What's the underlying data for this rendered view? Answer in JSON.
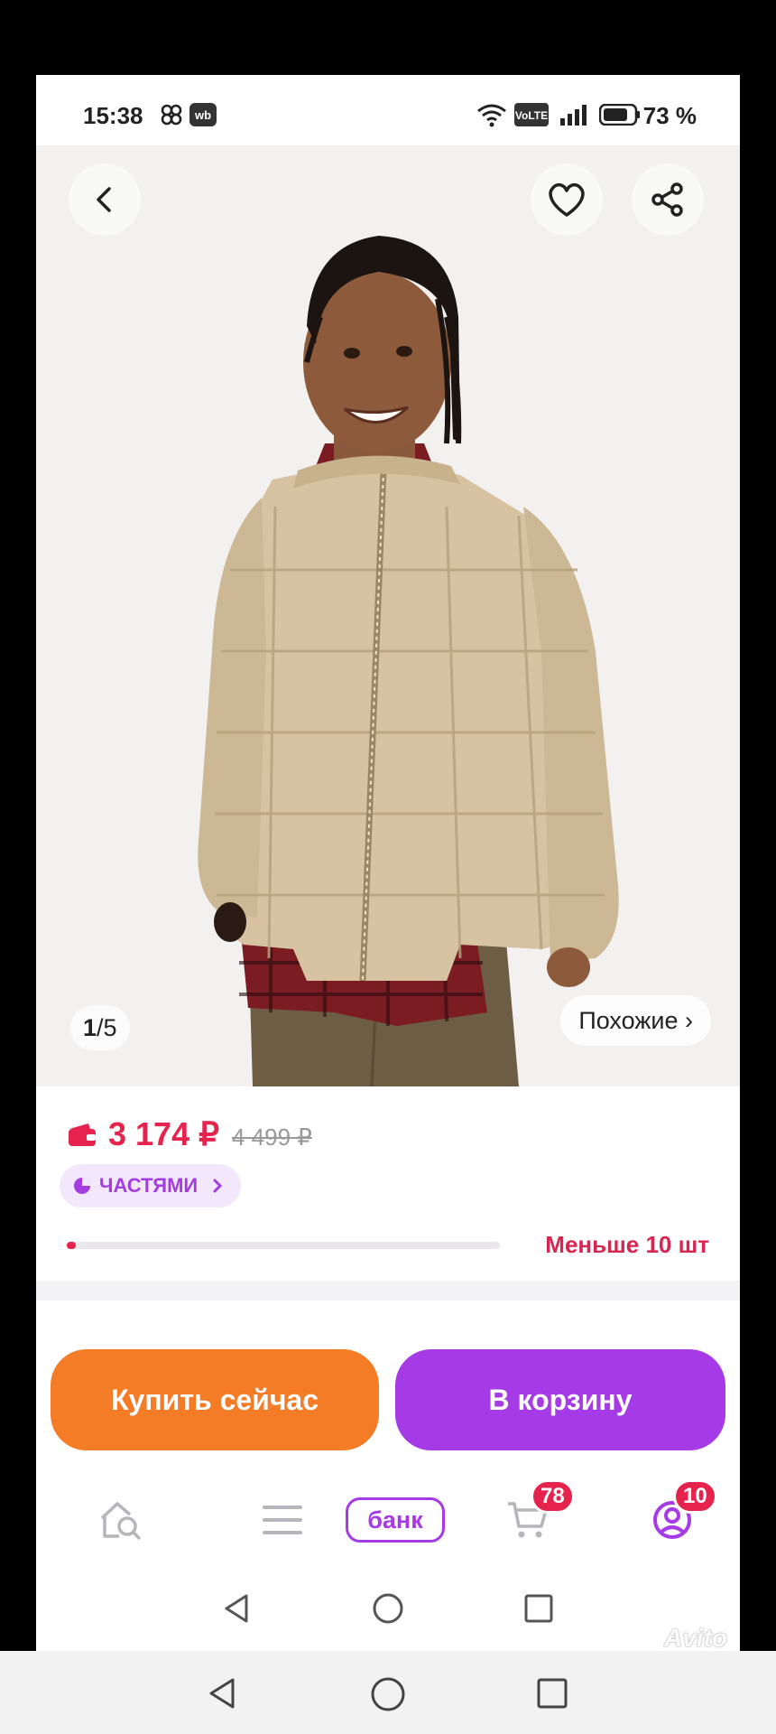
{
  "status_bar": {
    "time": "15:38",
    "app_icons": [
      "pinwheel-icon",
      "wb-icon"
    ],
    "network": "VoLTE",
    "battery": "73 %"
  },
  "gallery": {
    "current": "1",
    "separator": "/",
    "total": "5",
    "similar_label": "Похожие ›"
  },
  "price": {
    "current": "3 174 ₽",
    "old": "4 499 ₽",
    "installments_label": "ЧАСТЯМИ",
    "stock_label": "Меньше 10 шт",
    "stock_fraction": 0.02
  },
  "actions": {
    "buy_now": "Купить сейчас",
    "add_to_cart": "В корзину"
  },
  "bottom_nav": {
    "bank_label": "банк",
    "cart_badge": "78",
    "profile_badge": "10"
  },
  "watermark": "Avito",
  "colors": {
    "price_red": "#e5234d",
    "buy_orange": "#f47c27",
    "cart_purple": "#a53ae6"
  }
}
